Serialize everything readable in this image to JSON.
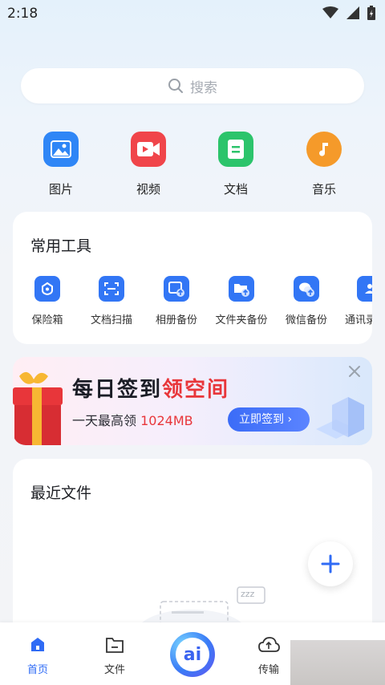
{
  "status": {
    "time": "2:18"
  },
  "search": {
    "placeholder": "搜索"
  },
  "categories": [
    {
      "label": "图片",
      "icon": "image-icon",
      "color": "#2f86f6"
    },
    {
      "label": "视频",
      "icon": "video-icon",
      "color": "#f0454a"
    },
    {
      "label": "文档",
      "icon": "document-icon",
      "color": "#2cc46b"
    },
    {
      "label": "音乐",
      "icon": "music-icon",
      "color": "#f59a2a"
    }
  ],
  "tools": {
    "title": "常用工具",
    "items": [
      {
        "label": "保险箱",
        "icon": "safe-icon"
      },
      {
        "label": "文档扫描",
        "icon": "scan-icon"
      },
      {
        "label": "相册备份",
        "icon": "album-backup-icon"
      },
      {
        "label": "文件夹备份",
        "icon": "folder-backup-icon"
      },
      {
        "label": "微信备份",
        "icon": "wechat-backup-icon"
      },
      {
        "label": "通讯录",
        "icon": "contacts-backup-icon"
      }
    ]
  },
  "banner": {
    "title_black": "每日签到",
    "title_red": "领空间",
    "sub_prefix": "一天最高领",
    "sub_highlight": "1024MB",
    "button": "立即签到 ›"
  },
  "recent": {
    "title": "最近文件",
    "empty_badge": "zzz"
  },
  "nav": {
    "items": [
      {
        "label": "首页",
        "icon": "home-icon"
      },
      {
        "label": "文件",
        "icon": "folder-icon"
      },
      {
        "label": "传输",
        "icon": "transfer-icon"
      }
    ],
    "ai_label": "ai"
  },
  "colors": {
    "accent": "#2f6bf5",
    "red": "#e8363a"
  }
}
